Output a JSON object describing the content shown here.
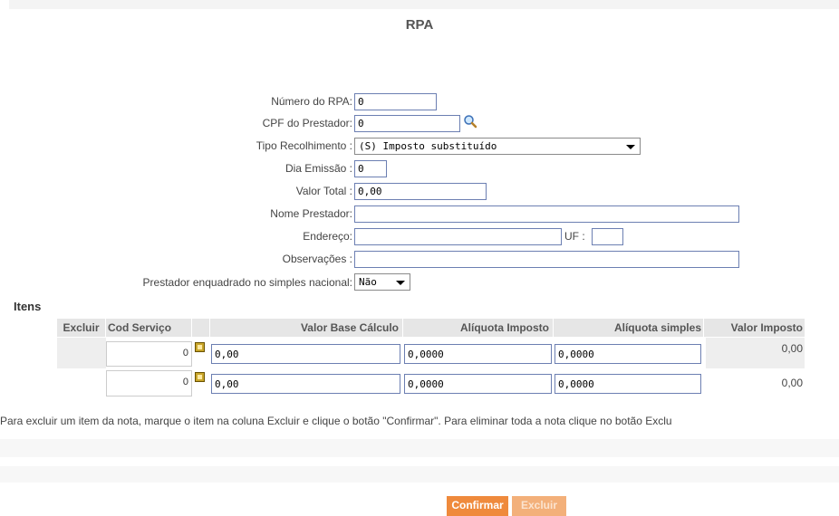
{
  "title": "RPA",
  "form": {
    "numero_label": "Número do RPA:",
    "numero_value": "0",
    "cpf_label": "CPF do Prestador:",
    "cpf_value": "0",
    "tipo_label": "Tipo Recolhimento :",
    "tipo_value": "(S) Imposto substituído",
    "dia_label": "Dia Emissão :",
    "dia_value": "0",
    "valor_label": "Valor Total :",
    "valor_value": "0,00",
    "nome_label": "Nome Prestador:",
    "nome_value": "",
    "endereco_label": "Endereço:",
    "endereco_value": "",
    "uf_label": "UF :",
    "uf_value": "",
    "obs_label": "Observações :",
    "obs_value": "",
    "simples_label": "Prestador enquadrado no simples nacional:",
    "simples_value": "Não"
  },
  "itens": {
    "title": "Itens",
    "headers": {
      "excluir": "Excluir",
      "cod": "Cod Serviço",
      "base": "Valor Base Cálculo",
      "aliq": "Alíquota Imposto",
      "simples": "Alíquota simples",
      "valor": "Valor Imposto"
    },
    "rows": [
      {
        "cod": "0",
        "base": "0,00",
        "aliq": "0,0000",
        "simples": "0,0000",
        "valor": "0,00"
      },
      {
        "cod": "0",
        "base": "0,00",
        "aliq": "0,0000",
        "simples": "0,0000",
        "valor": "0,00"
      }
    ]
  },
  "note": "Para excluir um item da nota, marque o item na coluna Excluir e clique o botão \"Confirmar\".  Para eliminar toda a nota clique no botão Exclu",
  "buttons": {
    "confirmar": "Confirmar",
    "excluir": "Excluir"
  },
  "colors": {
    "button": "#ef8a3c",
    "input_border": "#6c7fb2",
    "header_bg": "#e6e6e6"
  },
  "icons": {
    "search": "magnifier-icon",
    "edit": "edit-icon"
  }
}
